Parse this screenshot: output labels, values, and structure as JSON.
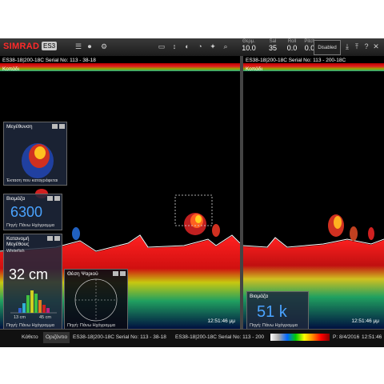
{
  "toolbar": {
    "logo": "SIMRAD",
    "model": "ES3",
    "readouts": [
      {
        "label": "Θερμ.",
        "value": "10.0"
      },
      {
        "label": "Sal",
        "value": "35"
      },
      {
        "label": "Roll",
        "value": "0.0"
      },
      {
        "label": "Pitch",
        "value": "0.0"
      }
    ],
    "status_label": "Disabled"
  },
  "left_pane": {
    "title": "ES38-18|200-18C Serial No: 113 - 38-18",
    "channel": "Κοπάδι",
    "timestamp": "12:51:46 μμ"
  },
  "right_pane": {
    "title": "ES38-18|200-18C Serial No: 113 - 200-18C",
    "channel": "Κοπάδι",
    "timestamp": "12:51:46 μμ"
  },
  "windows": {
    "size_zoom": {
      "title": "Μεγέθυνση",
      "footer": "Έκταση που καταγράφεται"
    },
    "biomass_left": {
      "title": "Βιομάζα",
      "value": "6300",
      "footer": "Πηγή: Πάνω Ηχόγραμμα"
    },
    "size_distribution": {
      "title": "Κατανομή Μεγέθους",
      "sub": "Whitefish",
      "value": "32 cm",
      "xmin": "13 cm",
      "xmax": "45 cm",
      "footer": "Πηγή: Πάνω Ηχόγραμμα"
    },
    "fish_position": {
      "title": "Θέση Ψαριού",
      "footer": "Πηγή: Πάνω Ηχόγραμμα"
    },
    "biomass_right": {
      "title": "Βιομάζα",
      "value": "51 k",
      "footer": "Πηγή: Πάνω Ηχόγραμμα"
    }
  },
  "statusbar": {
    "tabs": [
      "Κάθετο",
      "Οριζόντιο",
      "ES38-18|200-18C Serial No: 113 - 38-18",
      "ES38-18|200-18C Serial No: 113 - 200"
    ],
    "date": "P: 8/4/2016",
    "time": "12:51:46"
  }
}
